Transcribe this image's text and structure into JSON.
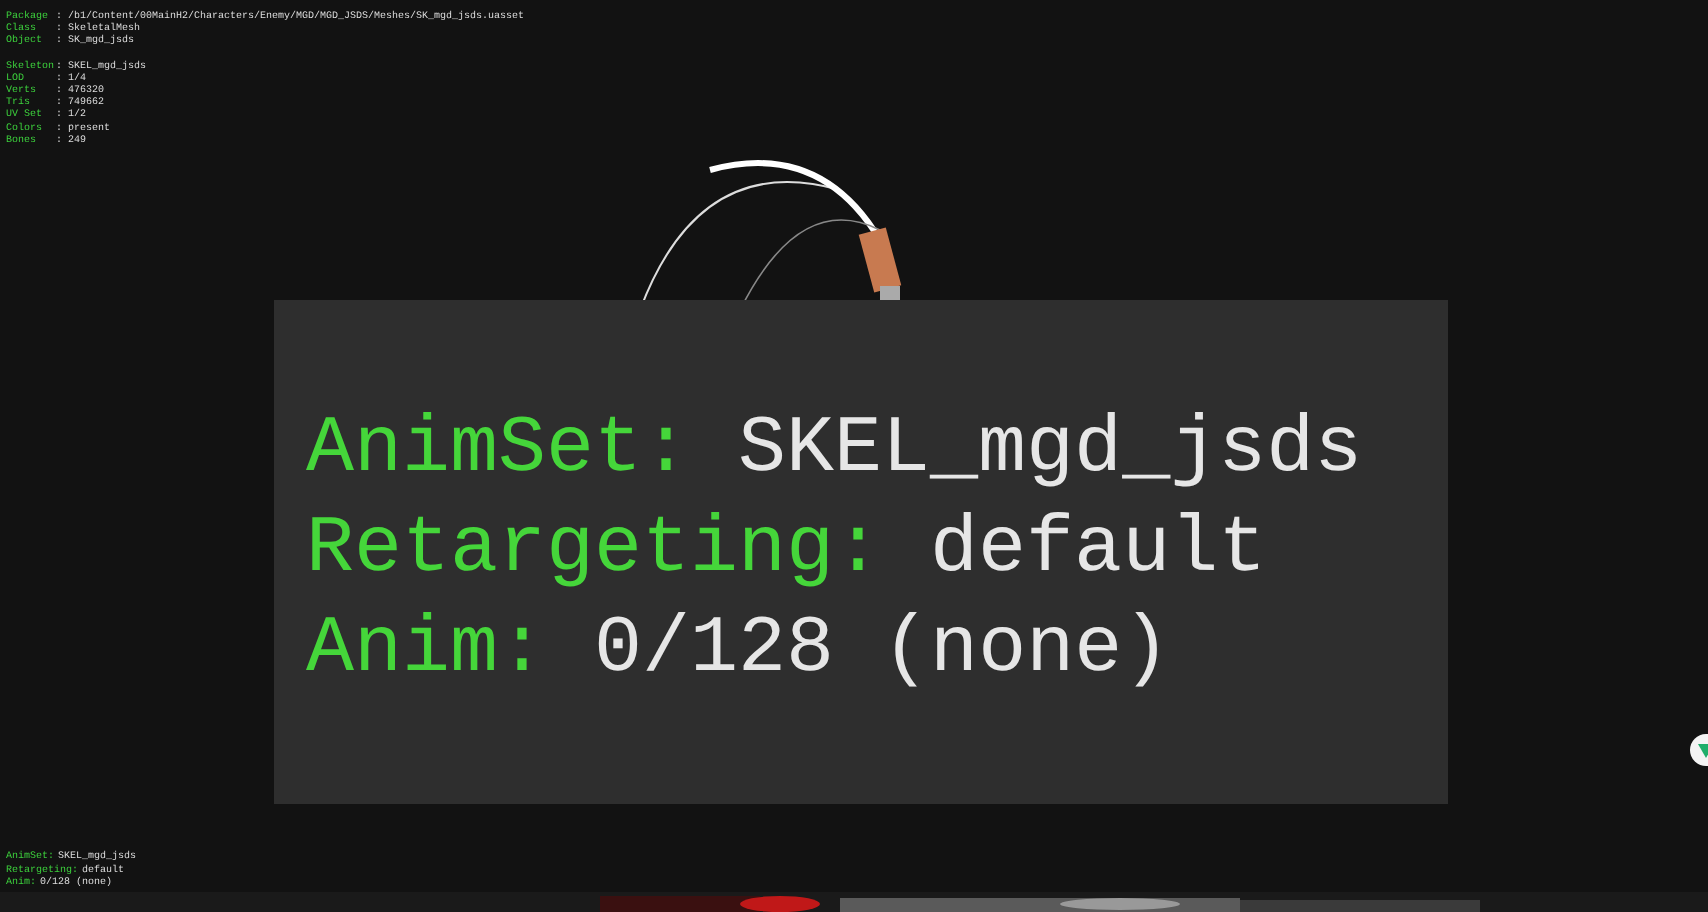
{
  "mesh_info": [
    {
      "label": "Package",
      "value": ": /b1/Content/00MainH2/Characters/Enemy/MGD/MGD_JSDS/Meshes/SK_mgd_jsds.uasset"
    },
    {
      "label": "Class",
      "value": ": SkeletalMesh"
    },
    {
      "label": "Object",
      "value": ": SK_mgd_jsds"
    }
  ],
  "mesh_stats": [
    {
      "label": "Skeleton",
      "value": ": SKEL_mgd_jsds"
    },
    {
      "label": "LOD",
      "value": ": 1/4"
    },
    {
      "label": "Verts",
      "value": ": 476320"
    },
    {
      "label": "Tris",
      "value": ": 749662"
    },
    {
      "label": "UV Set",
      "value": ": 1/2"
    },
    {
      "label": "Colors",
      "value": ": present"
    },
    {
      "label": "Bones",
      "value": ": 249"
    }
  ],
  "anim_info": [
    {
      "label": "AnimSet:",
      "value": "SKEL_mgd_jsds"
    },
    {
      "label": "Retargeting:",
      "value": "default"
    },
    {
      "label": "Anim:",
      "value": "0/128 (none)"
    }
  ],
  "zoom_panel": [
    {
      "label": "AnimSet:",
      "value": "SKEL_mgd_jsds"
    },
    {
      "label": "Retargeting:",
      "value": "default"
    },
    {
      "label": "Anim:",
      "value": "0/128 (none)"
    }
  ]
}
